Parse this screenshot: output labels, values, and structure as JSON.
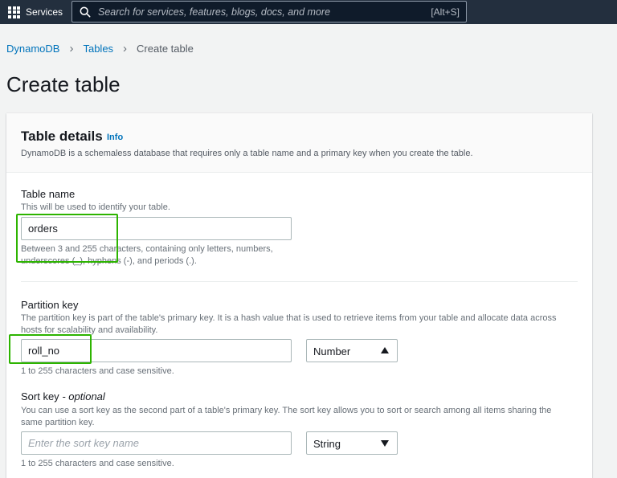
{
  "topnav": {
    "services_label": "Services",
    "search_placeholder": "Search for services, features, blogs, docs, and more",
    "search_shortcut": "[Alt+S]"
  },
  "breadcrumb": {
    "items": [
      "DynamoDB",
      "Tables"
    ],
    "current": "Create table"
  },
  "page_title": "Create table",
  "panel": {
    "title": "Table details",
    "info_label": "Info",
    "description": "DynamoDB is a schemaless database that requires only a table name and a primary key when you create the table."
  },
  "table_name": {
    "label": "Table name",
    "description": "This will be used to identify your table.",
    "value": "orders",
    "constraint": "Between 3 and 255 characters, containing only letters, numbers, underscores (_), hyphens (-), and periods (.)."
  },
  "partition_key": {
    "label": "Partition key",
    "description": "The partition key is part of the table's primary key. It is a hash value that is used to retrieve items from your table and allocate data across hosts for scalability and availability.",
    "value": "roll_no",
    "type": "Number",
    "type_open": true,
    "constraint": "1 to 255 characters and case sensitive."
  },
  "sort_key": {
    "label": "Sort key",
    "optional_label": "- optional",
    "description": "You can use a sort key as the second part of a table's primary key. The sort key allows you to sort or search among all items sharing the same partition key.",
    "placeholder": "Enter the sort key name",
    "type": "String",
    "constraint": "1 to 255 characters and case sensitive."
  },
  "colors": {
    "nav_bg": "#232f3e",
    "link": "#0073bb",
    "highlight": "#2db400"
  }
}
